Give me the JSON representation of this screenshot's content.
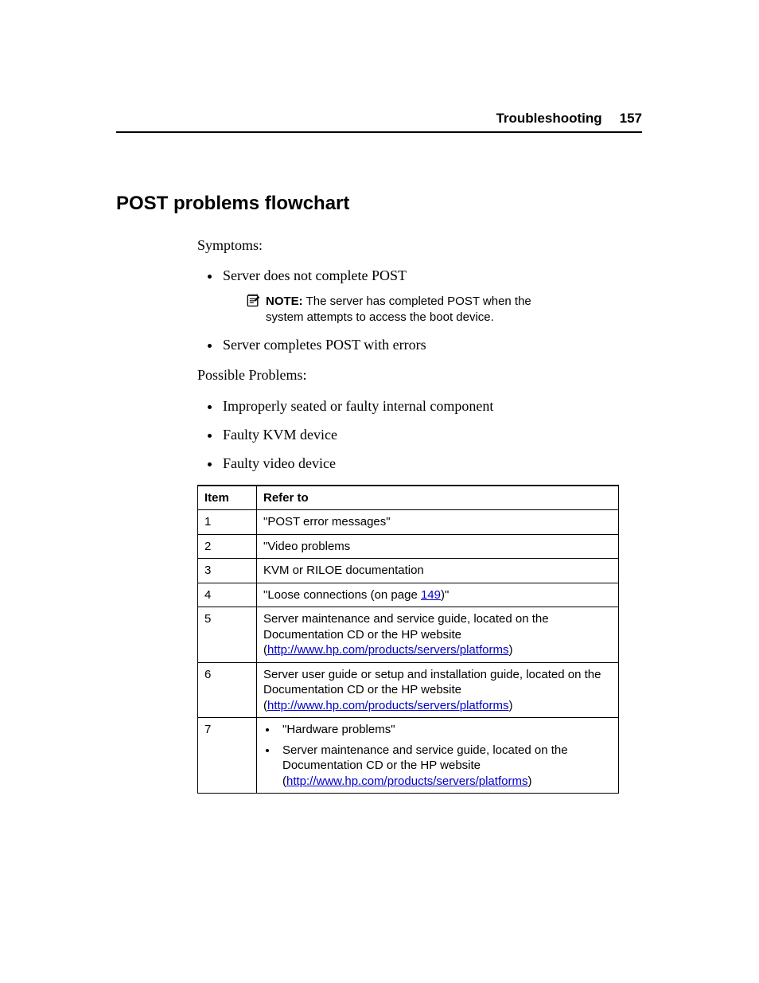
{
  "header": {
    "section": "Troubleshooting",
    "page": "157"
  },
  "title": "POST problems flowchart",
  "intro": {
    "symptoms_label": "Symptoms:",
    "symptoms": [
      "Server does not complete POST",
      "Server completes POST with errors"
    ],
    "note": {
      "label": "NOTE:",
      "text": "The server has completed POST when the system attempts to access the boot device."
    },
    "possible_label": "Possible Problems:",
    "possible": [
      "Improperly seated or faulty internal component",
      "Faulty KVM device",
      "Faulty video device"
    ]
  },
  "table": {
    "headers": {
      "item": "Item",
      "refer": "Refer to"
    },
    "rows": [
      {
        "item": "1",
        "refer_plain": "\"POST error messages\""
      },
      {
        "item": "2",
        "refer_plain": "\"Video problems"
      },
      {
        "item": "3",
        "refer_plain": "KVM or RILOE documentation"
      },
      {
        "item": "4",
        "refer_parts": {
          "pre": "\"Loose connections (on page ",
          "link": "149",
          "post": ")\""
        }
      },
      {
        "item": "5",
        "refer_parts": {
          "pre": "Server maintenance and service guide, located on the Documentation CD or the HP website (",
          "link": "http://www.hp.com/products/servers/platforms",
          "post": ")"
        }
      },
      {
        "item": "6",
        "refer_parts": {
          "pre": "Server user guide or setup and installation guide, located on the Documentation CD or the HP website (",
          "link": "http://www.hp.com/products/servers/platforms",
          "post": ")"
        }
      },
      {
        "item": "7",
        "list": [
          {
            "plain": "\"Hardware problems\""
          },
          {
            "parts": {
              "pre": "Server maintenance and service guide, located on the Documentation CD or the HP website (",
              "link": "http://www.hp.com/products/servers/platforms",
              "post": ")"
            }
          }
        ]
      }
    ]
  }
}
